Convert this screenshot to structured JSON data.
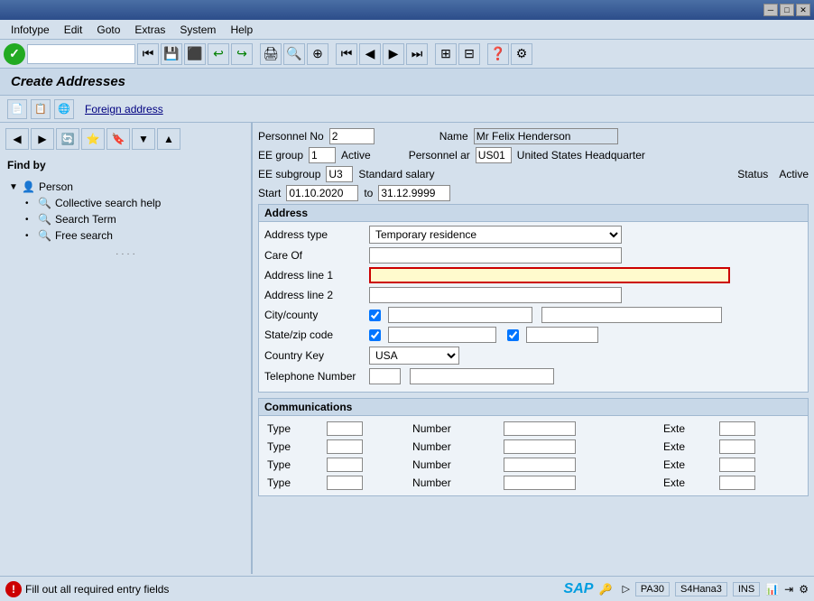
{
  "titlebar": {
    "buttons": [
      "─",
      "□",
      "✕"
    ]
  },
  "menubar": {
    "items": [
      "Infotype",
      "Edit",
      "Goto",
      "Extras",
      "System",
      "Help"
    ]
  },
  "toolbar": {
    "combo_placeholder": "",
    "buttons": [
      "◀◀",
      "◀",
      "▶",
      "▶▶"
    ]
  },
  "page_title": "Create Addresses",
  "subtoolbar": {
    "foreign_address": "Foreign address"
  },
  "personnel": {
    "no_label": "Personnel No",
    "no_value": "2",
    "name_label": "Name",
    "name_value": "Mr Felix Henderson",
    "ee_group_label": "EE group",
    "ee_group_value": "1",
    "active_label": "Active",
    "personnel_ar_label": "Personnel ar",
    "personnel_ar_value": "US01",
    "hq_label": "United States Headquarter",
    "ee_subgroup_label": "EE subgroup",
    "ee_subgroup_value": "U3",
    "standard_salary_label": "Standard salary",
    "status_label": "Status",
    "status_value": "Active",
    "start_label": "Start",
    "start_value": "01.10.2020",
    "to_label": "to",
    "end_value": "31.12.9999"
  },
  "findby": {
    "label": "Find by",
    "tree": {
      "person_label": "Person",
      "collective_search_label": "Collective search help",
      "search_term_label": "Search Term",
      "free_search_label": "Free search"
    }
  },
  "address_section": {
    "title": "Address",
    "fields": {
      "address_type_label": "Address type",
      "address_type_value": "Temporary residence",
      "care_of_label": "Care Of",
      "address_line1_label": "Address line 1",
      "address_line2_label": "Address line 2",
      "city_county_label": "City/county",
      "state_zip_label": "State/zip code",
      "country_key_label": "Country Key",
      "country_key_value": "USA",
      "telephone_label": "Telephone Number"
    }
  },
  "communications_section": {
    "title": "Communications",
    "rows": [
      {
        "type_label": "Type",
        "number_label": "Number",
        "exte_label": "Exte"
      },
      {
        "type_label": "Type",
        "number_label": "Number",
        "exte_label": "Exte"
      },
      {
        "type_label": "Type",
        "number_label": "Number",
        "exte_label": "Exte"
      },
      {
        "type_label": "Type",
        "number_label": "Number",
        "exte_label": "Exte"
      }
    ]
  },
  "statusbar": {
    "error_text": "Fill out all required entry fields",
    "system": "PA30",
    "server": "S4Hana3",
    "mode": "INS",
    "sap_label": "SAP"
  }
}
